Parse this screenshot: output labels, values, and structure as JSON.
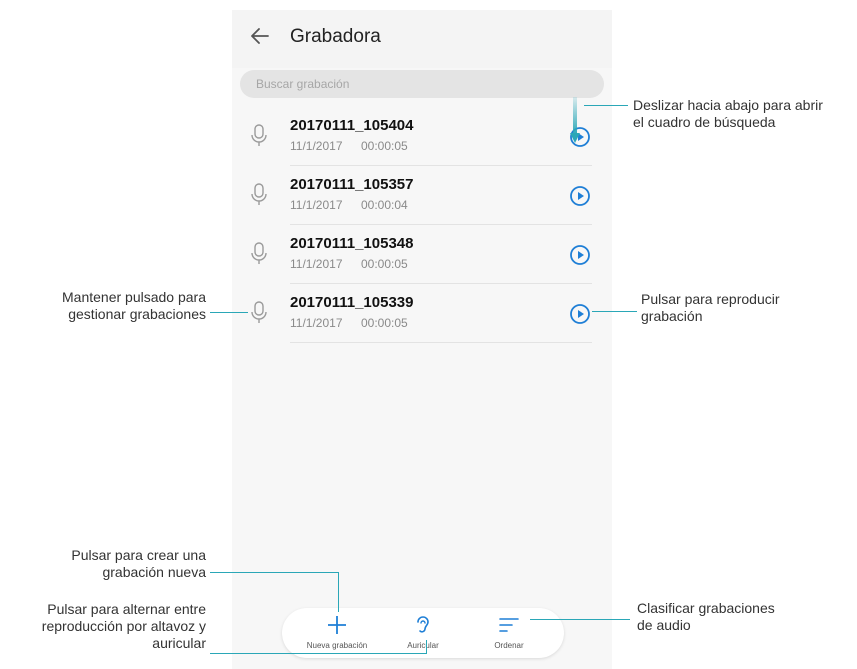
{
  "app": {
    "title": "Grabadora",
    "back_icon": "arrow-left-icon",
    "search_placeholder": "Buscar grabación"
  },
  "recordings": [
    {
      "name": "20170111_105404",
      "date": "11/1/2017",
      "duration": "00:00:05"
    },
    {
      "name": "20170111_105357",
      "date": "11/1/2017",
      "duration": "00:00:04"
    },
    {
      "name": "20170111_105348",
      "date": "11/1/2017",
      "duration": "00:00:05"
    },
    {
      "name": "20170111_105339",
      "date": "11/1/2017",
      "duration": "00:00:05"
    }
  ],
  "toolbar": {
    "new_recording": "Nueva grabación",
    "earpiece": "Auricular",
    "sort": "Ordenar"
  },
  "callouts": {
    "swipe_down_1": "Deslizar hacia abajo para abrir",
    "swipe_down_2": "el cuadro de búsqueda",
    "long_press_1": "Mantener pulsado para",
    "long_press_2": "gestionar grabaciones",
    "play_1": "Pulsar para reproducir",
    "play_2": "grabación",
    "create_1": "Pulsar para crear una",
    "create_2": "grabación nueva",
    "toggle_1": "Pulsar para alternar entre",
    "toggle_2": "reproducción por altavoz y",
    "toggle_3": "auricular",
    "sort_1": "Clasificar grabaciones",
    "sort_2": "de audio"
  },
  "colors": {
    "accent": "#1f7fd6",
    "callout_line": "#2aa7b7",
    "icon_gray": "#9a9a9a"
  }
}
